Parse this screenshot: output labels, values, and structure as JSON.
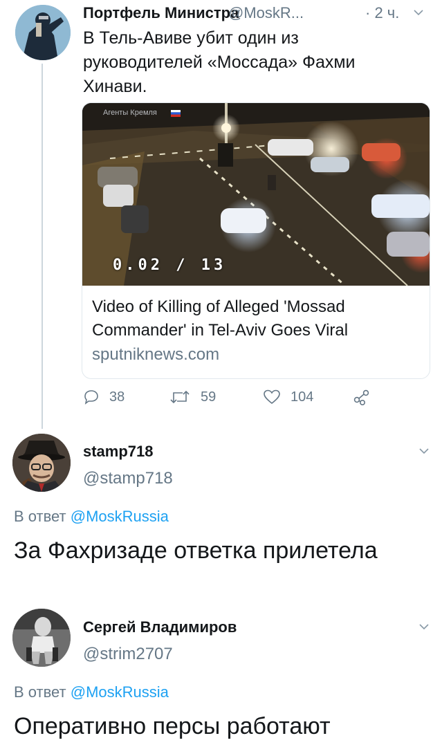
{
  "tweet1": {
    "author_name": "Портфель Министра",
    "author_handle": "@MoskR...",
    "time": "· 2 ч.",
    "text": "В Тель-Авиве убит один из руководителей «Моссада» Фахми Хинави.",
    "card": {
      "watermark": "Агенты Кремля",
      "timestamp": "0.02 / 13",
      "title": "Video of Killing of Alleged 'Mossad Commander' in Tel-Aviv Goes Viral",
      "domain": "sputniknews.com"
    },
    "actions": {
      "replies": "38",
      "retweets": "59",
      "likes": "104"
    }
  },
  "reply1": {
    "author_name": "stamp718",
    "author_handle": "@stamp718",
    "reply_prefix": "В ответ",
    "reply_to": "@MoskRussia",
    "text": "За Фахризаде ответка прилетела"
  },
  "reply2": {
    "author_name": "Сергей Владимиров",
    "author_handle": "@strim2707",
    "reply_prefix": "В ответ",
    "reply_to": "@MoskRussia",
    "text": "Оперативно персы работают"
  },
  "colors": {
    "accent": "#1da1f2",
    "secondary_text": "#657786",
    "line": "#ccd6dd"
  },
  "icons": [
    "reply-icon",
    "retweet-icon",
    "like-icon",
    "share-icon",
    "chevron-down-icon"
  ]
}
